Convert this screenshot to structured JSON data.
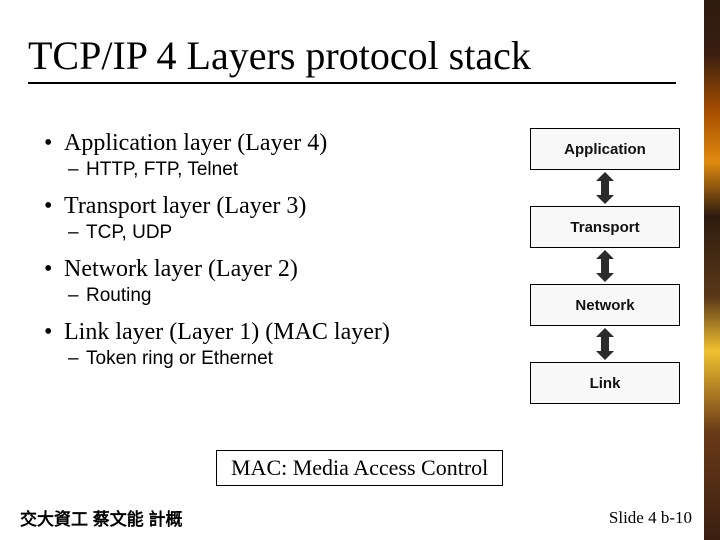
{
  "title": "TCP/IP 4 Layers protocol stack",
  "bullets": [
    {
      "label": "Application layer (Layer 4)",
      "sub": "HTTP, FTP, Telnet"
    },
    {
      "label": "Transport layer   (Layer 3)",
      "sub": "TCP, UDP"
    },
    {
      "label": "Network layer   (Layer 2)",
      "sub": "Routing"
    },
    {
      "label": "Link layer   (Layer 1) (MAC layer)",
      "sub": "Token ring or Ethernet"
    }
  ],
  "stack": {
    "layer0": "Application",
    "layer1": "Transport",
    "layer2": "Network",
    "layer3": "Link"
  },
  "mac_note": "MAC: Media Access Control",
  "footer_left": "交大資工 蔡文能 計概",
  "footer_right": "Slide 4 b-10"
}
